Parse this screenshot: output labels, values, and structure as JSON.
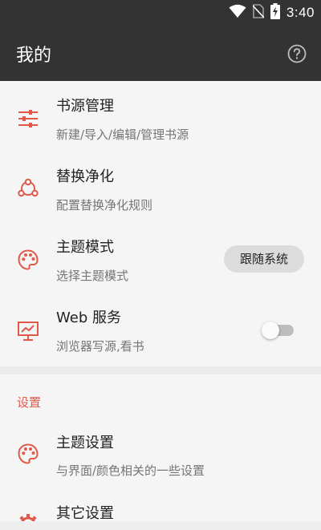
{
  "status_bar": {
    "time": "3:40",
    "icons": [
      "wifi-icon",
      "no-sim-icon",
      "battery-charging-icon"
    ]
  },
  "app_bar": {
    "title": "我的",
    "help_icon": "help-circle-icon"
  },
  "items": [
    {
      "title": "书源管理",
      "subtitle": "新建/导入/编辑/管理书源",
      "icon": "sliders-icon"
    },
    {
      "title": "替换净化",
      "subtitle": "配置替换净化规则",
      "icon": "share-nodes-icon"
    },
    {
      "title": "主题模式",
      "subtitle": "选择主题模式",
      "icon": "palette-icon",
      "value": "跟随系统"
    },
    {
      "title": "Web 服务",
      "subtitle": "浏览器写源,看书",
      "icon": "monitor-chart-icon",
      "switch_on": false
    }
  ],
  "settings_section": {
    "title": "设置",
    "items": [
      {
        "title": "主题设置",
        "subtitle": "与界面/颜色相关的一些设置",
        "icon": "palette-icon"
      },
      {
        "title": "其它设置",
        "icon": "gear-icon"
      }
    ]
  },
  "colors": {
    "accent": "#e05a4a",
    "app_bar": "#333333",
    "background": "#f5f5f5"
  }
}
